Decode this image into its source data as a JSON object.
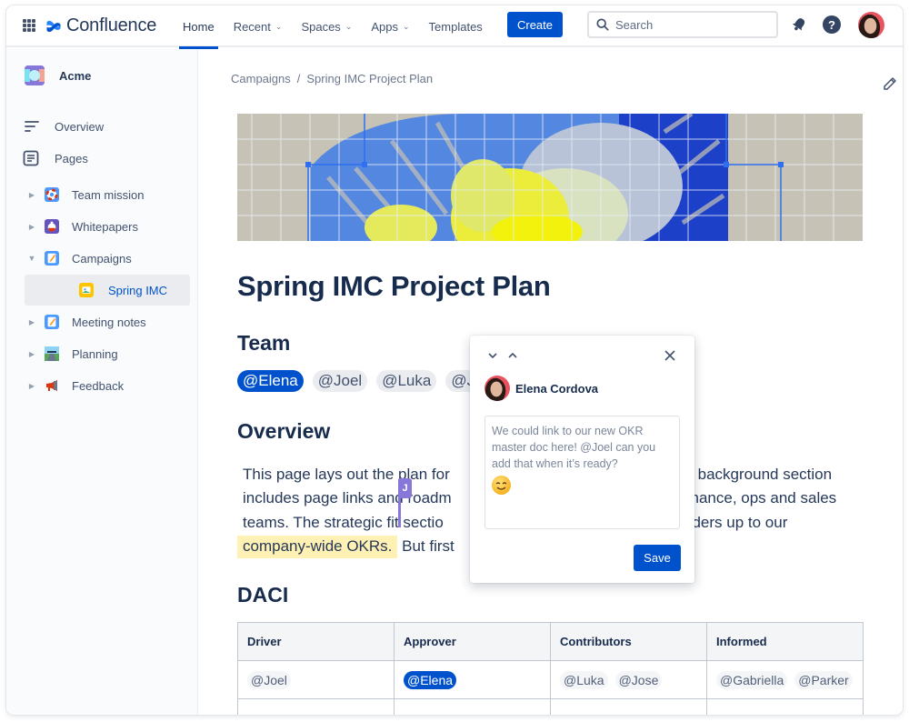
{
  "topnav": {
    "product_name": "Confluence",
    "items": [
      {
        "label": "Home",
        "active": true,
        "dropdown": false
      },
      {
        "label": "Recent",
        "active": false,
        "dropdown": true
      },
      {
        "label": "Spaces",
        "active": false,
        "dropdown": true
      },
      {
        "label": "Apps",
        "active": false,
        "dropdown": true
      },
      {
        "label": "Templates",
        "active": false,
        "dropdown": false
      }
    ],
    "create_label": "Create",
    "search_placeholder": "Search",
    "icons": [
      "app-switcher-icon",
      "confluence-logo-icon",
      "search-icon",
      "notifications-bell-icon",
      "help-icon",
      "user-avatar"
    ]
  },
  "sidebar": {
    "space_name": "Acme",
    "overview_label": "Overview",
    "pages_label": "Pages",
    "tree": [
      {
        "label": "Team mission",
        "icon": "lifebuoy-icon",
        "expanded": false,
        "selected": false,
        "level": 1
      },
      {
        "label": "Whitepapers",
        "icon": "potion-icon",
        "expanded": false,
        "selected": false,
        "level": 1
      },
      {
        "label": "Campaigns",
        "icon": "memo-icon",
        "expanded": true,
        "selected": false,
        "level": 1
      },
      {
        "label": "Spring IMC",
        "icon": "image-icon",
        "expanded": false,
        "selected": true,
        "level": 2
      },
      {
        "label": "Meeting notes",
        "icon": "memo-icon",
        "expanded": false,
        "selected": false,
        "level": 1
      },
      {
        "label": "Planning",
        "icon": "road-icon",
        "expanded": false,
        "selected": false,
        "level": 1
      },
      {
        "label": "Feedback",
        "icon": "megaphone-icon",
        "expanded": false,
        "selected": false,
        "level": 1
      }
    ]
  },
  "page": {
    "breadcrumb": [
      "Campaigns",
      "Spring IMC Project Plan"
    ],
    "breadcrumb_separator": "/",
    "title": "Spring IMC Project Plan",
    "team_heading": "Team",
    "team_mentions": [
      {
        "label": "@Elena",
        "self": true
      },
      {
        "label": "@Joel",
        "self": false
      },
      {
        "label": "@Luka",
        "self": false
      },
      {
        "label": "@J",
        "self": false
      }
    ],
    "overview_heading": "Overview",
    "overview_lines": [
      {
        "left": "This page lays out the plan for",
        "right": "he background section"
      },
      {
        "left": "includes page links and roadm",
        "right": "finance, ops and sales"
      },
      {
        "left": "teams. The strategic fit sectio",
        "right": "dders up to our"
      }
    ],
    "overview_highlight": "company-wide OKRs.",
    "overview_tail": " But first",
    "collab_cursor_initial": "J",
    "daci_heading": "DACI",
    "daci_table": {
      "headers": [
        "Driver",
        "Approver",
        "Contributors",
        "Informed"
      ],
      "rows": [
        [
          [
            {
              "label": "@Joel",
              "self": false
            }
          ],
          [
            {
              "label": "@Elena",
              "self": true
            }
          ],
          [
            {
              "label": "@Luka",
              "self": false
            },
            {
              "label": "@Jose",
              "self": false
            }
          ],
          [
            {
              "label": "@Gabriella",
              "self": false
            },
            {
              "label": "@Parker",
              "self": false
            }
          ]
        ]
      ]
    }
  },
  "comment": {
    "author": "Elena Cordova",
    "text": "We could link to our new OKR master doc here! @Joel can you add that when it’s ready?",
    "emoji": "smiling-face-icon",
    "save_label": "Save"
  },
  "colors": {
    "brand_blue": "#0052cc",
    "text_dark": "#172b4d",
    "highlight": "#fff0b3",
    "cursor_purple": "#8777d9"
  }
}
